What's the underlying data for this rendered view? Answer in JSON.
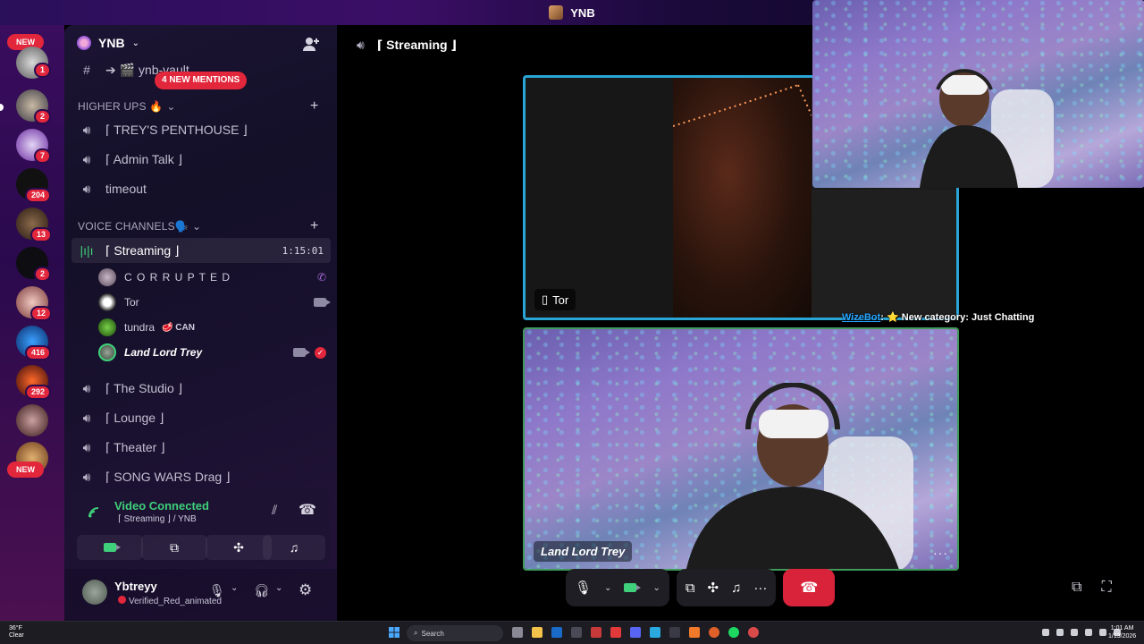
{
  "window": {
    "title": "YNB"
  },
  "rail": {
    "new_top": "NEW",
    "new_bottom": "NEW",
    "badges": [
      "1",
      "2",
      "7",
      "204",
      "13",
      "2",
      "12",
      "416",
      "292"
    ]
  },
  "server": {
    "name": "YNB"
  },
  "channels": {
    "text_channel": "➔ 🎬 ynb-vault",
    "mentions_pill": "4 NEW MENTIONS",
    "cat_higher_ups": "HIGHER UPS 🔥",
    "higher_ups": [
      {
        "label": "⌈ TREY'S PENTHOUSE ⌋"
      },
      {
        "label": "⌈ Admin Talk ⌋"
      },
      {
        "label": "timeout"
      }
    ],
    "cat_voice": "VOICE CHANNELS🗣️",
    "active_voice": {
      "label": "⌈ Streaming ⌋",
      "time": "1:15:01"
    },
    "members": [
      {
        "name": "C O R R U P T E D"
      },
      {
        "name": "Tor"
      },
      {
        "name": "tundra",
        "tag": "🥩 CAN"
      },
      {
        "name": "Land Lord Trey"
      }
    ],
    "other_voice": [
      {
        "label": "⌈ The Studio ⌋"
      },
      {
        "label": "⌈ Lounge ⌋"
      },
      {
        "label": "⌈ Theater ⌋"
      },
      {
        "label": "⌈ SONG WARS Drag ⌋"
      }
    ]
  },
  "voice_panel": {
    "status": "Video Connected",
    "location": "⌈ Streaming ⌋ / YNB"
  },
  "user": {
    "name": "Ybtreyy",
    "status": "Verified_Red_animated"
  },
  "main": {
    "header": "⌈ Streaming ⌋",
    "tiles": [
      {
        "label": "Tor",
        "icon": "phone-icon"
      },
      {
        "label": "Land Lord Trey"
      }
    ],
    "chat_overlay": {
      "bot": "WizeBot",
      "message": ": ⭐ New category: Just Chatting"
    }
  },
  "taskbar": {
    "weather_temp": "36°F",
    "weather_desc": "Clear",
    "search": "Search",
    "time": "1:01 AM",
    "date": "1/13/2026"
  },
  "colors": {
    "accent_green": "#3ed07a",
    "danger": "#d8233a",
    "speaking_border": "#2aa6d6",
    "badge_red": "#e2263b"
  }
}
